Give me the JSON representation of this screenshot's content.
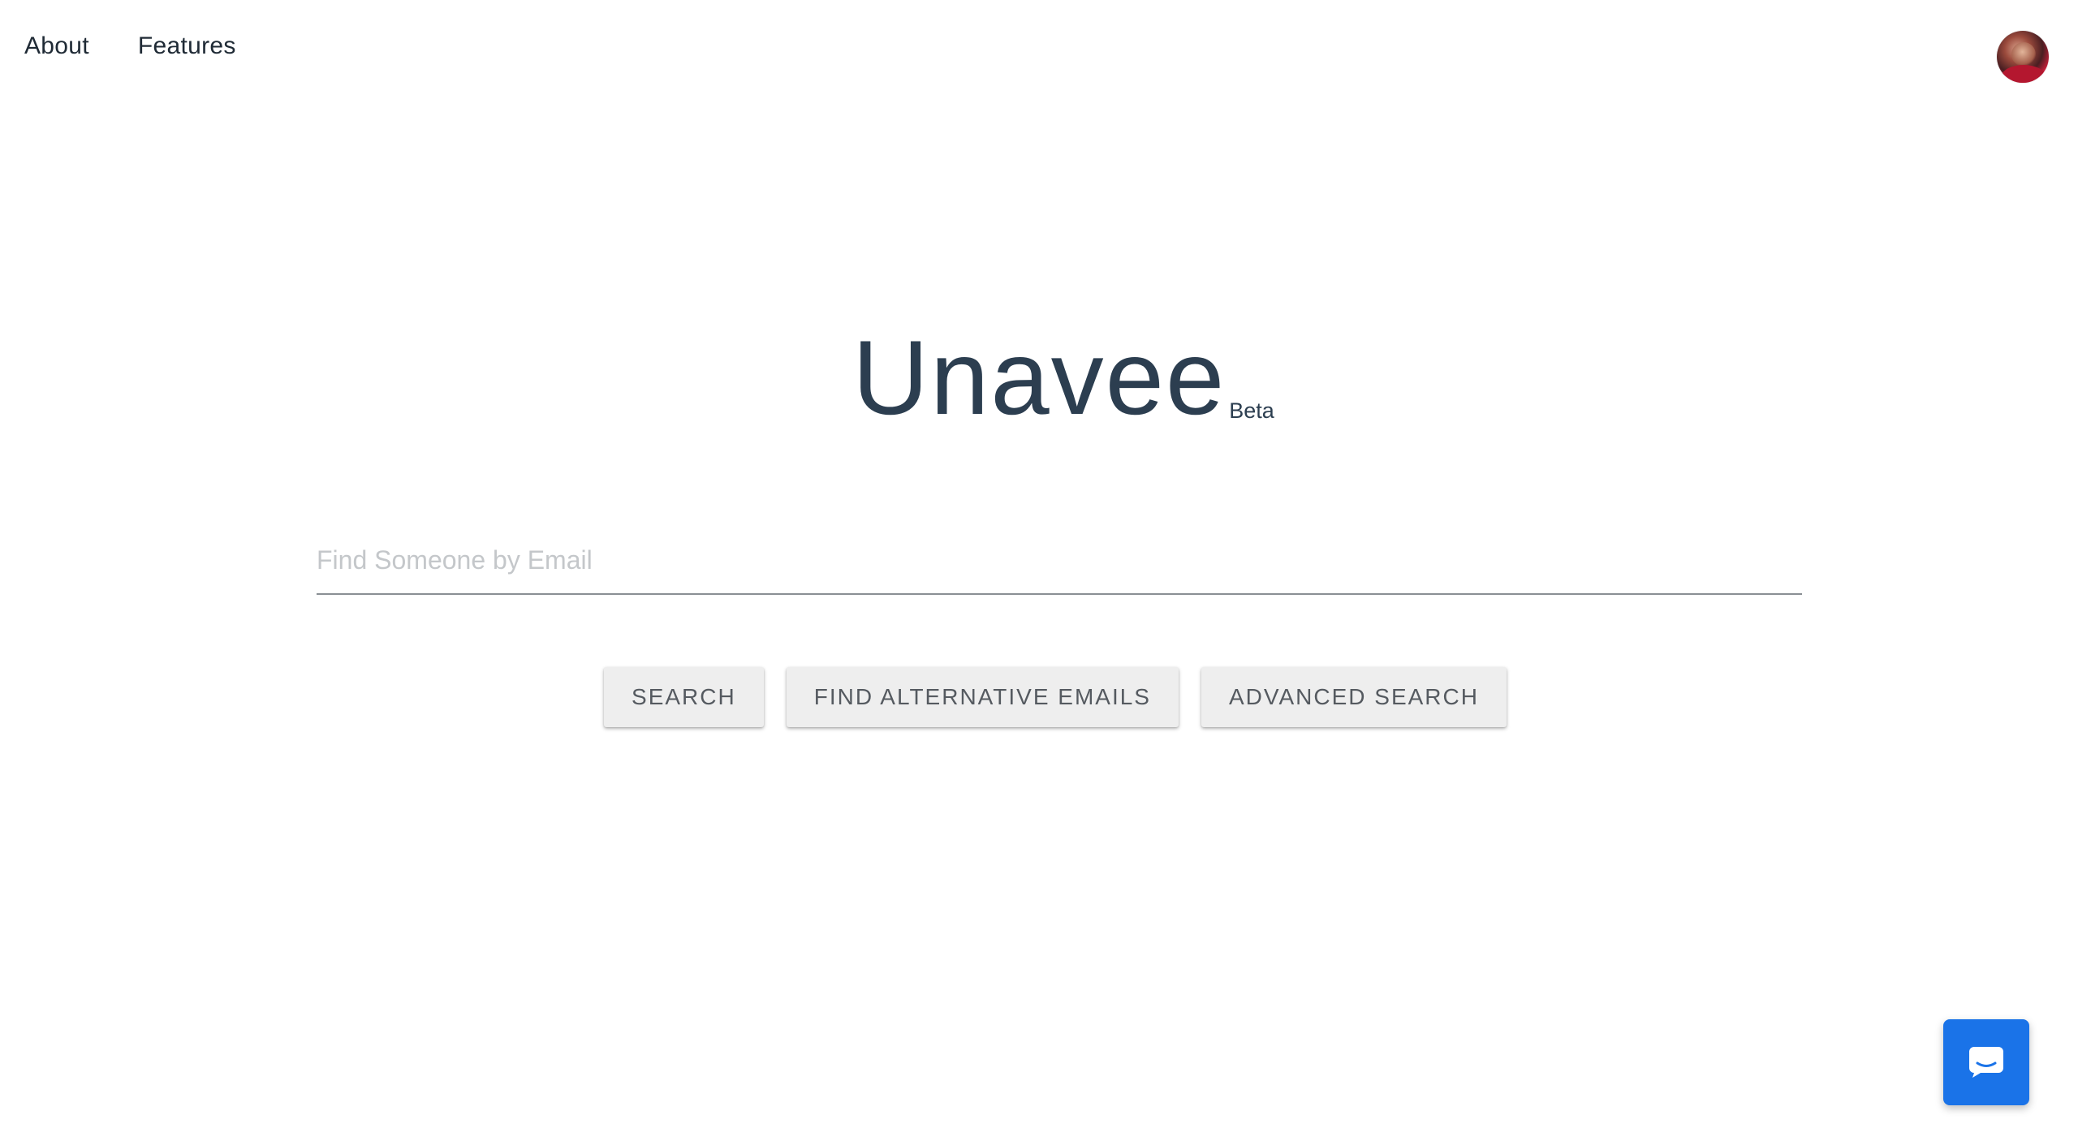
{
  "nav": {
    "about_label": "About",
    "features_label": "Features"
  },
  "brand": {
    "title": "Unavee",
    "badge": "Beta"
  },
  "search": {
    "placeholder": "Find Someone by Email",
    "value": ""
  },
  "buttons": {
    "search_label": "SEARCH",
    "alternative_label": "FIND ALTERNATIVE EMAILS",
    "advanced_label": "ADVANCED SEARCH"
  },
  "icons": {
    "avatar": "user-avatar",
    "chat": "chat-bubble-icon"
  },
  "colors": {
    "title": "#2c3e50",
    "chat_button": "#1a73e8",
    "button_bg": "#eeeeee"
  }
}
